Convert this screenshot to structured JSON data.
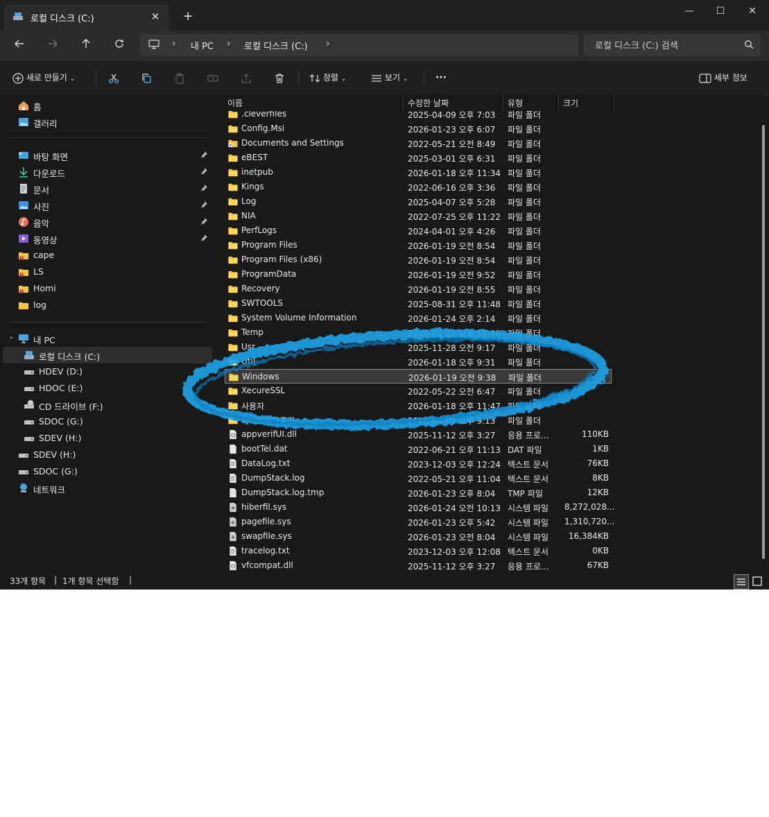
{
  "tab": {
    "title": "로컬 디스크 (C:)"
  },
  "window": {
    "minimize_glyph": "—",
    "maximize_glyph": "☐",
    "close_glyph": "✕"
  },
  "address": {
    "crumbs": [
      "내 PC",
      "로컬 디스크 (C:)"
    ]
  },
  "search": {
    "placeholder": "로컬 디스크 (C:) 검색"
  },
  "toolbar": {
    "new_label": "새로 만들기",
    "sort_label": "정렬",
    "view_label": "보기",
    "more_label": "···",
    "details_label": "세부 정보"
  },
  "sidebar": {
    "home": "홈",
    "gallery": "갤러리",
    "quick": [
      "바탕 화면",
      "다운로드",
      "문서",
      "사진",
      "음악",
      "동영상"
    ],
    "folders": [
      "cape",
      "LS",
      "Homi",
      "log"
    ],
    "this_pc": "내 PC",
    "drives": [
      "로컬 디스크 (C:)",
      "HDEV (D:)",
      "HDOC (E:)",
      "CD 드라이브 (F:)",
      "SDOC (G:)",
      "SDEV (H:)"
    ],
    "external": [
      "SDEV (H:)",
      "SDOC (G:)"
    ],
    "network": "네트워크"
  },
  "columns": {
    "name": "이름",
    "date": "수정한 날짜",
    "type": "유형",
    "size": "크기"
  },
  "files": [
    {
      "name": ".cleverfiles",
      "date": "2025-04-09 오후 7:03",
      "type": "파일 폴더",
      "size": "",
      "icon": "folder-icon"
    },
    {
      "name": "Config.Msi",
      "date": "2026-01-23 오후 6:07",
      "type": "파일 폴더",
      "size": "",
      "icon": "folder-icon"
    },
    {
      "name": "Documents and Settings",
      "date": "2022-05-21 오전 8:49",
      "type": "파일 폴더",
      "size": "",
      "icon": "shortcut-folder-icon"
    },
    {
      "name": "eBEST",
      "date": "2025-03-01 오후 6:31",
      "type": "파일 폴더",
      "size": "",
      "icon": "folder-icon"
    },
    {
      "name": "inetpub",
      "date": "2026-01-18 오후 11:34",
      "type": "파일 폴더",
      "size": "",
      "icon": "folder-icon"
    },
    {
      "name": "Kings",
      "date": "2022-06-16 오후 3:36",
      "type": "파일 폴더",
      "size": "",
      "icon": "folder-icon"
    },
    {
      "name": "Log",
      "date": "2025-04-07 오후 5:28",
      "type": "파일 폴더",
      "size": "",
      "icon": "folder-icon"
    },
    {
      "name": "NIA",
      "date": "2022-07-25 오후 11:22",
      "type": "파일 폴더",
      "size": "",
      "icon": "folder-icon"
    },
    {
      "name": "PerfLogs",
      "date": "2024-04-01 오후 4:26",
      "type": "파일 폴더",
      "size": "",
      "icon": "folder-icon"
    },
    {
      "name": "Program Files",
      "date": "2026-01-19 오전 8:54",
      "type": "파일 폴더",
      "size": "",
      "icon": "folder-icon"
    },
    {
      "name": "Program Files (x86)",
      "date": "2026-01-19 오전 8:54",
      "type": "파일 폴더",
      "size": "",
      "icon": "folder-icon"
    },
    {
      "name": "ProgramData",
      "date": "2026-01-19 오전 9:52",
      "type": "파일 폴더",
      "size": "",
      "icon": "folder-icon"
    },
    {
      "name": "Recovery",
      "date": "2026-01-19 오전 8:55",
      "type": "파일 폴더",
      "size": "",
      "icon": "folder-icon"
    },
    {
      "name": "SWTOOLS",
      "date": "2025-08-31 오후 11:48",
      "type": "파일 폴더",
      "size": "",
      "icon": "folder-icon"
    },
    {
      "name": "System Volume Information",
      "date": "2026-01-24 오후 2:14",
      "type": "파일 폴더",
      "size": "",
      "icon": "folder-icon"
    },
    {
      "name": "Temp",
      "date": "2026-01-22 오후 12:46",
      "type": "파일 폴더",
      "size": "",
      "icon": "folder-icon"
    },
    {
      "name": "Usr",
      "date": "2025-11-28 오전 9:17",
      "type": "파일 폴더",
      "size": "",
      "icon": "folder-icon"
    },
    {
      "name": "Util",
      "date": "2026-01-18 오후 9:31",
      "type": "파일 폴더",
      "size": "",
      "icon": "folder-icon"
    },
    {
      "name": "Windows",
      "date": "2026-01-19 오전 9:38",
      "type": "파일 폴더",
      "size": "",
      "icon": "folder-icon",
      "selected": true
    },
    {
      "name": "XecureSSL",
      "date": "2022-05-22 오전 6:47",
      "type": "파일 폴더",
      "size": "",
      "icon": "folder-icon"
    },
    {
      "name": "사용자",
      "date": "2026-01-18 오후 11:47",
      "type": "파일 폴더",
      "size": "",
      "icon": "folder-icon"
    },
    {
      "name": "케이프투자증권",
      "date": "2025-04-07 오후 9:13",
      "type": "파일 폴더",
      "size": "",
      "icon": "folder-icon"
    },
    {
      "name": "appverifUI.dll",
      "date": "2025-11-12 오후 3:27",
      "type": "응용 프로...",
      "size": "110KB",
      "icon": "dll-file-icon"
    },
    {
      "name": "bootTel.dat",
      "date": "2022-06-21 오후 11:13",
      "type": "DAT 파일",
      "size": "1KB",
      "icon": "file-icon"
    },
    {
      "name": "DataLog.txt",
      "date": "2023-12-03 오후 12:24",
      "type": "텍스트 문서",
      "size": "76KB",
      "icon": "text-file-icon"
    },
    {
      "name": "DumpStack.log",
      "date": "2022-05-21 오후 11:04",
      "type": "텍스트 문서",
      "size": "8KB",
      "icon": "text-file-icon"
    },
    {
      "name": "DumpStack.log.tmp",
      "date": "2026-01-23 오후 8:04",
      "type": "TMP 파일",
      "size": "12KB",
      "icon": "file-icon"
    },
    {
      "name": "hiberfil.sys",
      "date": "2026-01-24 오전 10:13",
      "type": "시스템 파일",
      "size": "8,272,028...",
      "icon": "system-file-icon"
    },
    {
      "name": "pagefile.sys",
      "date": "2026-01-23 오후 5:42",
      "type": "시스템 파일",
      "size": "1,310,720...",
      "icon": "system-file-icon"
    },
    {
      "name": "swapfile.sys",
      "date": "2026-01-23 오전 8:04",
      "type": "시스템 파일",
      "size": "16,384KB",
      "icon": "system-file-icon"
    },
    {
      "name": "tracelog.txt",
      "date": "2023-12-03 오후 12:08",
      "type": "텍스트 문서",
      "size": "0KB",
      "icon": "text-file-icon"
    },
    {
      "name": "vfcompat.dll",
      "date": "2025-11-12 오후 3:27",
      "type": "응용 프로...",
      "size": "67KB",
      "icon": "dll-file-icon"
    }
  ],
  "status": {
    "count": "33개 항목",
    "selected": "1개 항목 선택함",
    "sep": "|"
  },
  "colors": {
    "folder": "#f5c542",
    "accent": "#4aa3df",
    "annotation": "#1fa3e8"
  }
}
